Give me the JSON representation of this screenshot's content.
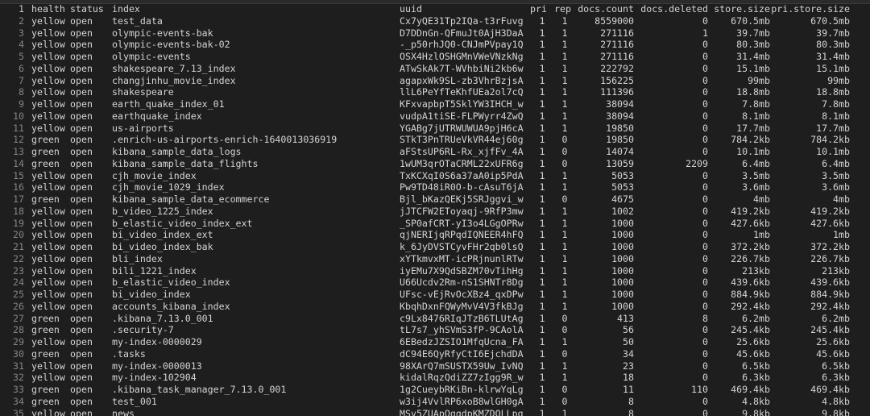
{
  "headers": {
    "ln": "1",
    "health": "health",
    "status": "status",
    "index": "index",
    "uuid": "uuid",
    "pri": "pri",
    "rep": "rep",
    "docs_count": "docs.count",
    "docs_deleted": "docs.deleted",
    "store_size": "store.size",
    "pri_store_size": "pri.store.size"
  },
  "rows": [
    {
      "ln": "2",
      "health": "yellow",
      "status": "open",
      "index": "test_data",
      "uuid": "Cx7yQE31Tp2IQa-t3rFuvg",
      "pri": "1",
      "rep": "1",
      "docs_count": "8559000",
      "docs_deleted": "0",
      "store_size": "670.5mb",
      "pri_store_size": "670.5mb"
    },
    {
      "ln": "3",
      "health": "yellow",
      "status": "open",
      "index": "olympic-events-bak",
      "uuid": "D7DDnGn-QFmuJt0AjH3DaA",
      "pri": "1",
      "rep": "1",
      "docs_count": "271116",
      "docs_deleted": "1",
      "store_size": "39.7mb",
      "pri_store_size": "39.7mb"
    },
    {
      "ln": "4",
      "health": "yellow",
      "status": "open",
      "index": "olympic-events-bak-02",
      "uuid": "-_p50rhJQ0-CNJmPVpay1Q",
      "pri": "1",
      "rep": "1",
      "docs_count": "271116",
      "docs_deleted": "0",
      "store_size": "80.3mb",
      "pri_store_size": "80.3mb"
    },
    {
      "ln": "5",
      "health": "yellow",
      "status": "open",
      "index": "olympic-events",
      "uuid": "OSX4HzlOSHGMnVWeVNzkNg",
      "pri": "1",
      "rep": "1",
      "docs_count": "271116",
      "docs_deleted": "0",
      "store_size": "31.4mb",
      "pri_store_size": "31.4mb"
    },
    {
      "ln": "6",
      "health": "yellow",
      "status": "open",
      "index": "shakespeare_7.13_index",
      "uuid": "ATwSkAk7T-WVhbiNi2kb6w",
      "pri": "1",
      "rep": "1",
      "docs_count": "222792",
      "docs_deleted": "0",
      "store_size": "15.1mb",
      "pri_store_size": "15.1mb"
    },
    {
      "ln": "7",
      "health": "yellow",
      "status": "open",
      "index": "changjinhu_movie_index",
      "uuid": "agapxWk9SL-zb3VhrBzjsA",
      "pri": "1",
      "rep": "1",
      "docs_count": "156225",
      "docs_deleted": "0",
      "store_size": "99mb",
      "pri_store_size": "99mb"
    },
    {
      "ln": "8",
      "health": "yellow",
      "status": "open",
      "index": "shakespeare",
      "uuid": "llL6PeYfTeKhfUEa2ol7cQ",
      "pri": "1",
      "rep": "1",
      "docs_count": "111396",
      "docs_deleted": "0",
      "store_size": "18.8mb",
      "pri_store_size": "18.8mb"
    },
    {
      "ln": "9",
      "health": "yellow",
      "status": "open",
      "index": "earth_quake_index_01",
      "uuid": "KFxvapbpT5SklYW3IHCH_w",
      "pri": "1",
      "rep": "1",
      "docs_count": "38094",
      "docs_deleted": "0",
      "store_size": "7.8mb",
      "pri_store_size": "7.8mb"
    },
    {
      "ln": "10",
      "health": "yellow",
      "status": "open",
      "index": "earthquake_index",
      "uuid": "vudpA1tiSE-FLPWyrr4ZwQ",
      "pri": "1",
      "rep": "1",
      "docs_count": "38094",
      "docs_deleted": "0",
      "store_size": "8.1mb",
      "pri_store_size": "8.1mb"
    },
    {
      "ln": "11",
      "health": "yellow",
      "status": "open",
      "index": "us-airports",
      "uuid": "YGABg7jUTRWUWUA9pjH6cA",
      "pri": "1",
      "rep": "1",
      "docs_count": "19850",
      "docs_deleted": "0",
      "store_size": "17.7mb",
      "pri_store_size": "17.7mb"
    },
    {
      "ln": "12",
      "health": "green",
      "status": "open",
      "index": ".enrich-us-airports-enrich-1640013036919",
      "uuid": "STkT3PnTRUeVkVR44ej60g",
      "pri": "1",
      "rep": "0",
      "docs_count": "19850",
      "docs_deleted": "0",
      "store_size": "784.2kb",
      "pri_store_size": "784.2kb"
    },
    {
      "ln": "13",
      "health": "green",
      "status": "open",
      "index": "kibana_sample_data_logs",
      "uuid": "aFStsUP6RL-Rx_xjfFv_4A",
      "pri": "1",
      "rep": "0",
      "docs_count": "14074",
      "docs_deleted": "0",
      "store_size": "10.1mb",
      "pri_store_size": "10.1mb"
    },
    {
      "ln": "14",
      "health": "green",
      "status": "open",
      "index": "kibana_sample_data_flights",
      "uuid": "1wUM3qrOTaCRML22xUFR6g",
      "pri": "1",
      "rep": "0",
      "docs_count": "13059",
      "docs_deleted": "2209",
      "store_size": "6.4mb",
      "pri_store_size": "6.4mb"
    },
    {
      "ln": "15",
      "health": "yellow",
      "status": "open",
      "index": "cjh_movie_index",
      "uuid": "TxKCXqI0S6a37aA0ip5PdA",
      "pri": "1",
      "rep": "1",
      "docs_count": "5053",
      "docs_deleted": "0",
      "store_size": "3.5mb",
      "pri_store_size": "3.5mb"
    },
    {
      "ln": "16",
      "health": "yellow",
      "status": "open",
      "index": "cjh_movie_1029_index",
      "uuid": "Pw9TD48iR0O-b-cAsuT6jA",
      "pri": "1",
      "rep": "1",
      "docs_count": "5053",
      "docs_deleted": "0",
      "store_size": "3.6mb",
      "pri_store_size": "3.6mb"
    },
    {
      "ln": "17",
      "health": "green",
      "status": "open",
      "index": "kibana_sample_data_ecommerce",
      "uuid": "Bjl_bKazQEKj5SRJggvi_w",
      "pri": "1",
      "rep": "0",
      "docs_count": "4675",
      "docs_deleted": "0",
      "store_size": "4mb",
      "pri_store_size": "4mb"
    },
    {
      "ln": "18",
      "health": "yellow",
      "status": "open",
      "index": "b_video_1225_index",
      "uuid": "jJTCFW2EToyaqj-9RfP3mw",
      "pri": "1",
      "rep": "1",
      "docs_count": "1002",
      "docs_deleted": "0",
      "store_size": "419.2kb",
      "pri_store_size": "419.2kb"
    },
    {
      "ln": "19",
      "health": "yellow",
      "status": "open",
      "index": "b_elastic_video_index_ext",
      "uuid": "_SP0afCRT-yI3o4LGgOPRw",
      "pri": "1",
      "rep": "1",
      "docs_count": "1000",
      "docs_deleted": "0",
      "store_size": "427.6kb",
      "pri_store_size": "427.6kb"
    },
    {
      "ln": "20",
      "health": "yellow",
      "status": "open",
      "index": "bi_video_index_ext",
      "uuid": "qjNERIjqRPqdIQNEER4hFQ",
      "pri": "1",
      "rep": "1",
      "docs_count": "1000",
      "docs_deleted": "0",
      "store_size": "1mb",
      "pri_store_size": "1mb"
    },
    {
      "ln": "21",
      "health": "yellow",
      "status": "open",
      "index": "bi_video_index_bak",
      "uuid": "k_6JyDVSTCyvFHr2qb0lsQ",
      "pri": "1",
      "rep": "1",
      "docs_count": "1000",
      "docs_deleted": "0",
      "store_size": "372.2kb",
      "pri_store_size": "372.2kb"
    },
    {
      "ln": "22",
      "health": "yellow",
      "status": "open",
      "index": "bli_index",
      "uuid": "xYTkmvxMT-icPRjnunlRTw",
      "pri": "1",
      "rep": "1",
      "docs_count": "1000",
      "docs_deleted": "0",
      "store_size": "226.7kb",
      "pri_store_size": "226.7kb"
    },
    {
      "ln": "23",
      "health": "yellow",
      "status": "open",
      "index": "bili_1221_index",
      "uuid": "iyEMu7X9QdSBZM70vTihHg",
      "pri": "1",
      "rep": "1",
      "docs_count": "1000",
      "docs_deleted": "0",
      "store_size": "213kb",
      "pri_store_size": "213kb"
    },
    {
      "ln": "24",
      "health": "yellow",
      "status": "open",
      "index": "b_elastic_video_index",
      "uuid": "U66Ucdv2Rm-nS1SHNTr8Dg",
      "pri": "1",
      "rep": "1",
      "docs_count": "1000",
      "docs_deleted": "0",
      "store_size": "439.6kb",
      "pri_store_size": "439.6kb"
    },
    {
      "ln": "25",
      "health": "yellow",
      "status": "open",
      "index": "bi_video_index",
      "uuid": "UFsc-vEjRvOcXBz4_qxDPw",
      "pri": "1",
      "rep": "1",
      "docs_count": "1000",
      "docs_deleted": "0",
      "store_size": "884.9kb",
      "pri_store_size": "884.9kb"
    },
    {
      "ln": "26",
      "health": "yellow",
      "status": "open",
      "index": "accounts_kibana_index",
      "uuid": "KbqhDxnFQWyMvV4V3fkBJg",
      "pri": "1",
      "rep": "1",
      "docs_count": "1000",
      "docs_deleted": "0",
      "store_size": "292.4kb",
      "pri_store_size": "292.4kb"
    },
    {
      "ln": "27",
      "health": "green",
      "status": "open",
      "index": ".kibana_7.13.0_001",
      "uuid": "c9Lx8476RIqJTzB6TLUtAg",
      "pri": "1",
      "rep": "0",
      "docs_count": "413",
      "docs_deleted": "8",
      "store_size": "6.2mb",
      "pri_store_size": "6.2mb"
    },
    {
      "ln": "28",
      "health": "green",
      "status": "open",
      "index": ".security-7",
      "uuid": "tL7s7_yhSVmS3fP-9CAolA",
      "pri": "1",
      "rep": "0",
      "docs_count": "56",
      "docs_deleted": "0",
      "store_size": "245.4kb",
      "pri_store_size": "245.4kb"
    },
    {
      "ln": "29",
      "health": "yellow",
      "status": "open",
      "index": "my-index-0000029",
      "uuid": "6EBedzJZSIO1MfqUcna_FA",
      "pri": "1",
      "rep": "1",
      "docs_count": "50",
      "docs_deleted": "0",
      "store_size": "25.6kb",
      "pri_store_size": "25.6kb"
    },
    {
      "ln": "30",
      "health": "green",
      "status": "open",
      "index": ".tasks",
      "uuid": "dC94E6QyRfyCtI6EjchdDA",
      "pri": "1",
      "rep": "0",
      "docs_count": "34",
      "docs_deleted": "0",
      "store_size": "45.6kb",
      "pri_store_size": "45.6kb"
    },
    {
      "ln": "31",
      "health": "yellow",
      "status": "open",
      "index": "my-index-0000013",
      "uuid": "98XArQ7mSUSTX59Uw_IvNQ",
      "pri": "1",
      "rep": "1",
      "docs_count": "23",
      "docs_deleted": "0",
      "store_size": "6.5kb",
      "pri_store_size": "6.5kb"
    },
    {
      "ln": "32",
      "health": "yellow",
      "status": "open",
      "index": "my-index-102904",
      "uuid": "kidalRqzQdiZZ7zIgg9R_w",
      "pri": "1",
      "rep": "1",
      "docs_count": "18",
      "docs_deleted": "0",
      "store_size": "6.3kb",
      "pri_store_size": "6.3kb"
    },
    {
      "ln": "33",
      "health": "green",
      "status": "open",
      "index": ".kibana_task_manager_7.13.0_001",
      "uuid": "1g2CueybRKiBn-klrwYqLg",
      "pri": "1",
      "rep": "0",
      "docs_count": "11",
      "docs_deleted": "110",
      "store_size": "469.4kb",
      "pri_store_size": "469.4kb"
    },
    {
      "ln": "34",
      "health": "green",
      "status": "open",
      "index": "test_001",
      "uuid": "w3ij4VvlRP6xoB8wlGH0gA",
      "pri": "1",
      "rep": "0",
      "docs_count": "8",
      "docs_deleted": "0",
      "store_size": "4.8kb",
      "pri_store_size": "4.8kb"
    },
    {
      "ln": "35",
      "health": "yellow",
      "status": "open",
      "index": "news",
      "uuid": "MSv5ZUApQgqdpKMZDOLLpg",
      "pri": "1",
      "rep": "1",
      "docs_count": "8",
      "docs_deleted": "0",
      "store_size": "9.8kb",
      "pri_store_size": "9.8kb"
    }
  ]
}
